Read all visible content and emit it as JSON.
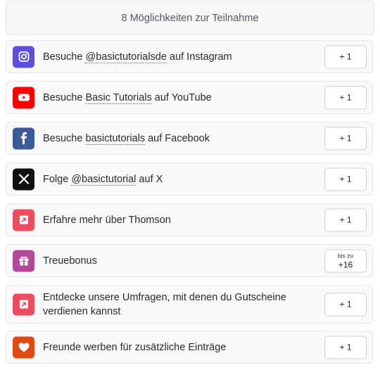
{
  "header": {
    "title": "8 Möglichkeiten zur Teilnahme"
  },
  "entries": [
    {
      "pre": "Besuche ",
      "link": "@basictutorialsde",
      "post": " auf Instagram",
      "points": "+ 1",
      "icon": "instagram-icon",
      "color": "#5b4fe0"
    },
    {
      "pre": "Besuche ",
      "link": "Basic Tutorials",
      "post": " auf YouTube",
      "points": "+ 1",
      "icon": "youtube-icon",
      "color": "#ff0000"
    },
    {
      "pre": "Besuche ",
      "link": "basictutorials",
      "post": " auf Facebook",
      "points": "+ 1",
      "icon": "facebook-icon",
      "color": "#3b5a9a"
    },
    {
      "pre": "Folge ",
      "link": "@basictutorial",
      "post": " auf X",
      "points": "+ 1",
      "icon": "x-icon",
      "color": "#111111"
    },
    {
      "text": "Erfahre mehr über Thomson",
      "points": "+ 1",
      "icon": "external-link-icon",
      "color": "#ee4b5e"
    },
    {
      "text": "Treuebonus",
      "points_prefix": "bis zu",
      "points": "+16",
      "icon": "gift-icon",
      "color": "#b3479a"
    },
    {
      "text": "Entdecke unsere Umfragen, mit denen du Gutscheine verdienen kannst",
      "points": "+ 1",
      "icon": "external-link-icon",
      "color": "#ee4b5e"
    },
    {
      "text": "Freunde werben für zusätzliche Einträge",
      "points": "+ 1",
      "icon": "heart-icon",
      "color": "#e04a12"
    }
  ]
}
